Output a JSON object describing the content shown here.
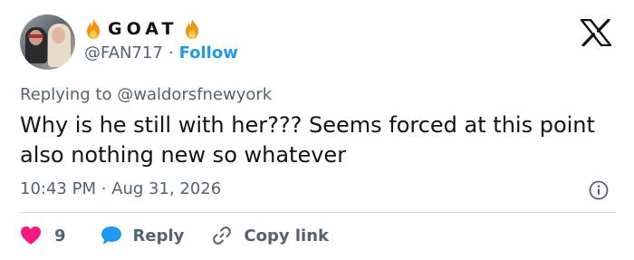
{
  "author": {
    "display_name": "GOAT",
    "handle": "@FAN717",
    "separator": "·",
    "follow_label": "Follow"
  },
  "replying_to": {
    "prefix": "Replying to",
    "mention": "@waldorsfnewyork"
  },
  "tweet": {
    "text": "Why is he still with her??? Seems forced at this point also nothing new so whatever",
    "time": "10:43 PM",
    "separator": "·",
    "date": "Aug 31, 2026"
  },
  "actions": {
    "like_count": "9",
    "reply_label": "Reply",
    "copy_label": "Copy link"
  },
  "icons": {
    "fire": "fire-emoji-icon",
    "logo": "x-logo-icon",
    "info": "info-icon",
    "like": "heart-icon",
    "reply": "speech-bubble-icon",
    "copy": "link-icon"
  },
  "colors": {
    "text": "#0f1419",
    "secondary": "#536471",
    "link": "#1d9bf0",
    "like": "#f91880",
    "divider": "#cfd9de"
  }
}
